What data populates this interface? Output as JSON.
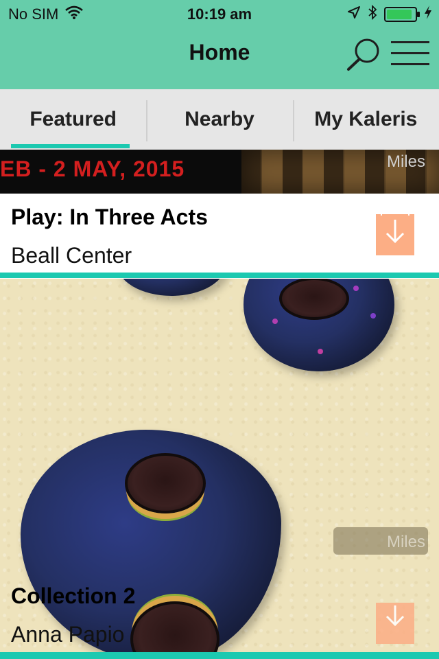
{
  "status_bar": {
    "carrier": "No SIM",
    "time": "10:19 am",
    "battery_level": 0.9,
    "icons": [
      "wifi-icon",
      "location-arrow-icon",
      "bluetooth-icon",
      "battery-icon",
      "charging-bolt-icon"
    ]
  },
  "nav": {
    "title": "Home",
    "search_icon": "search-icon",
    "menu_icon": "hamburger-menu-icon"
  },
  "tabs": [
    {
      "label": "Featured",
      "active": true
    },
    {
      "label": "Nearby",
      "active": false
    },
    {
      "label": "My Kaleris",
      "active": false
    }
  ],
  "cards": [
    {
      "banner_text": "EB - 2 MAY, 2015",
      "distance_label": "Miles",
      "title": "Play: In Three Acts",
      "subtitle": "Beall Center",
      "action_icon": "download-icon"
    },
    {
      "distance_label": "Miles",
      "title": "Collection 2",
      "subtitle": "Anna Papio",
      "action_icon": "download-icon"
    }
  ],
  "colors": {
    "header_bg": "#66cdaa",
    "accent": "#1cc9b0",
    "download_button": "#fcae85",
    "tab_bar_bg": "#e6e6e6"
  }
}
